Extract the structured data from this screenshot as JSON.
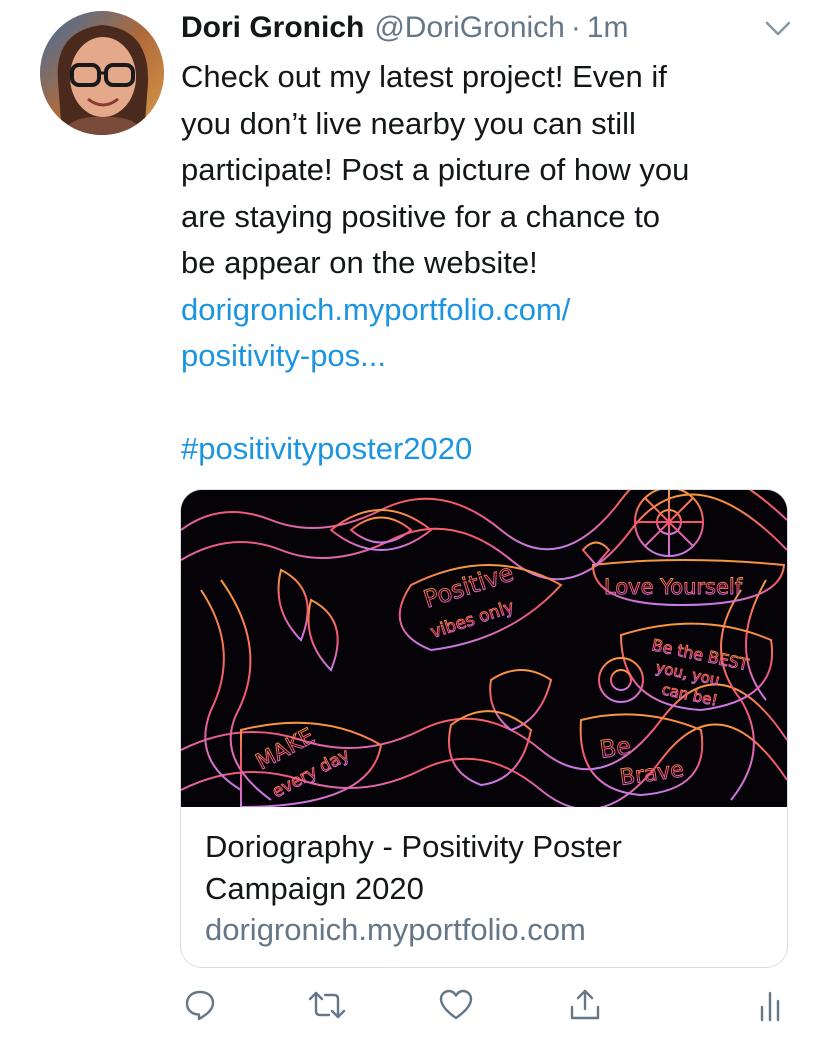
{
  "tweet": {
    "author_name": "Dori Gronich",
    "author_handle": "@DoriGronich",
    "separator": "·",
    "timestamp": "1m",
    "text_lines": [
      "Check out my latest project! Even if",
      "you don’t live nearby you can still",
      "participate! Post a picture of how you",
      "are staying positive for a chance to",
      "be appear on the website!"
    ],
    "link_line1": "dorigronich.myportfolio.com/",
    "link_line2": "positivity-pos...",
    "hashtag": "#positivityposter2020"
  },
  "card": {
    "title_line1": "Doriography - Positivity Poster",
    "title_line2": "Campaign 2020",
    "domain": "dorigronich.myportfolio.com",
    "image_text": {
      "positive": "Positive",
      "vibes": "vibes only",
      "love": "Love Yourself",
      "best1": "Be the BEST",
      "best2": "you, you",
      "best3": "can be!",
      "brave1": "Be",
      "brave2": "Brave",
      "make1": "MAKE",
      "make2": "every day"
    }
  },
  "actions": {
    "icons": [
      "reply-icon",
      "retweet-icon",
      "like-icon",
      "share-icon",
      "analytics-icon"
    ]
  },
  "colors": {
    "text": "#14171a",
    "secondary": "#657786",
    "link": "#1b95e0",
    "border": "#d8dee3"
  }
}
